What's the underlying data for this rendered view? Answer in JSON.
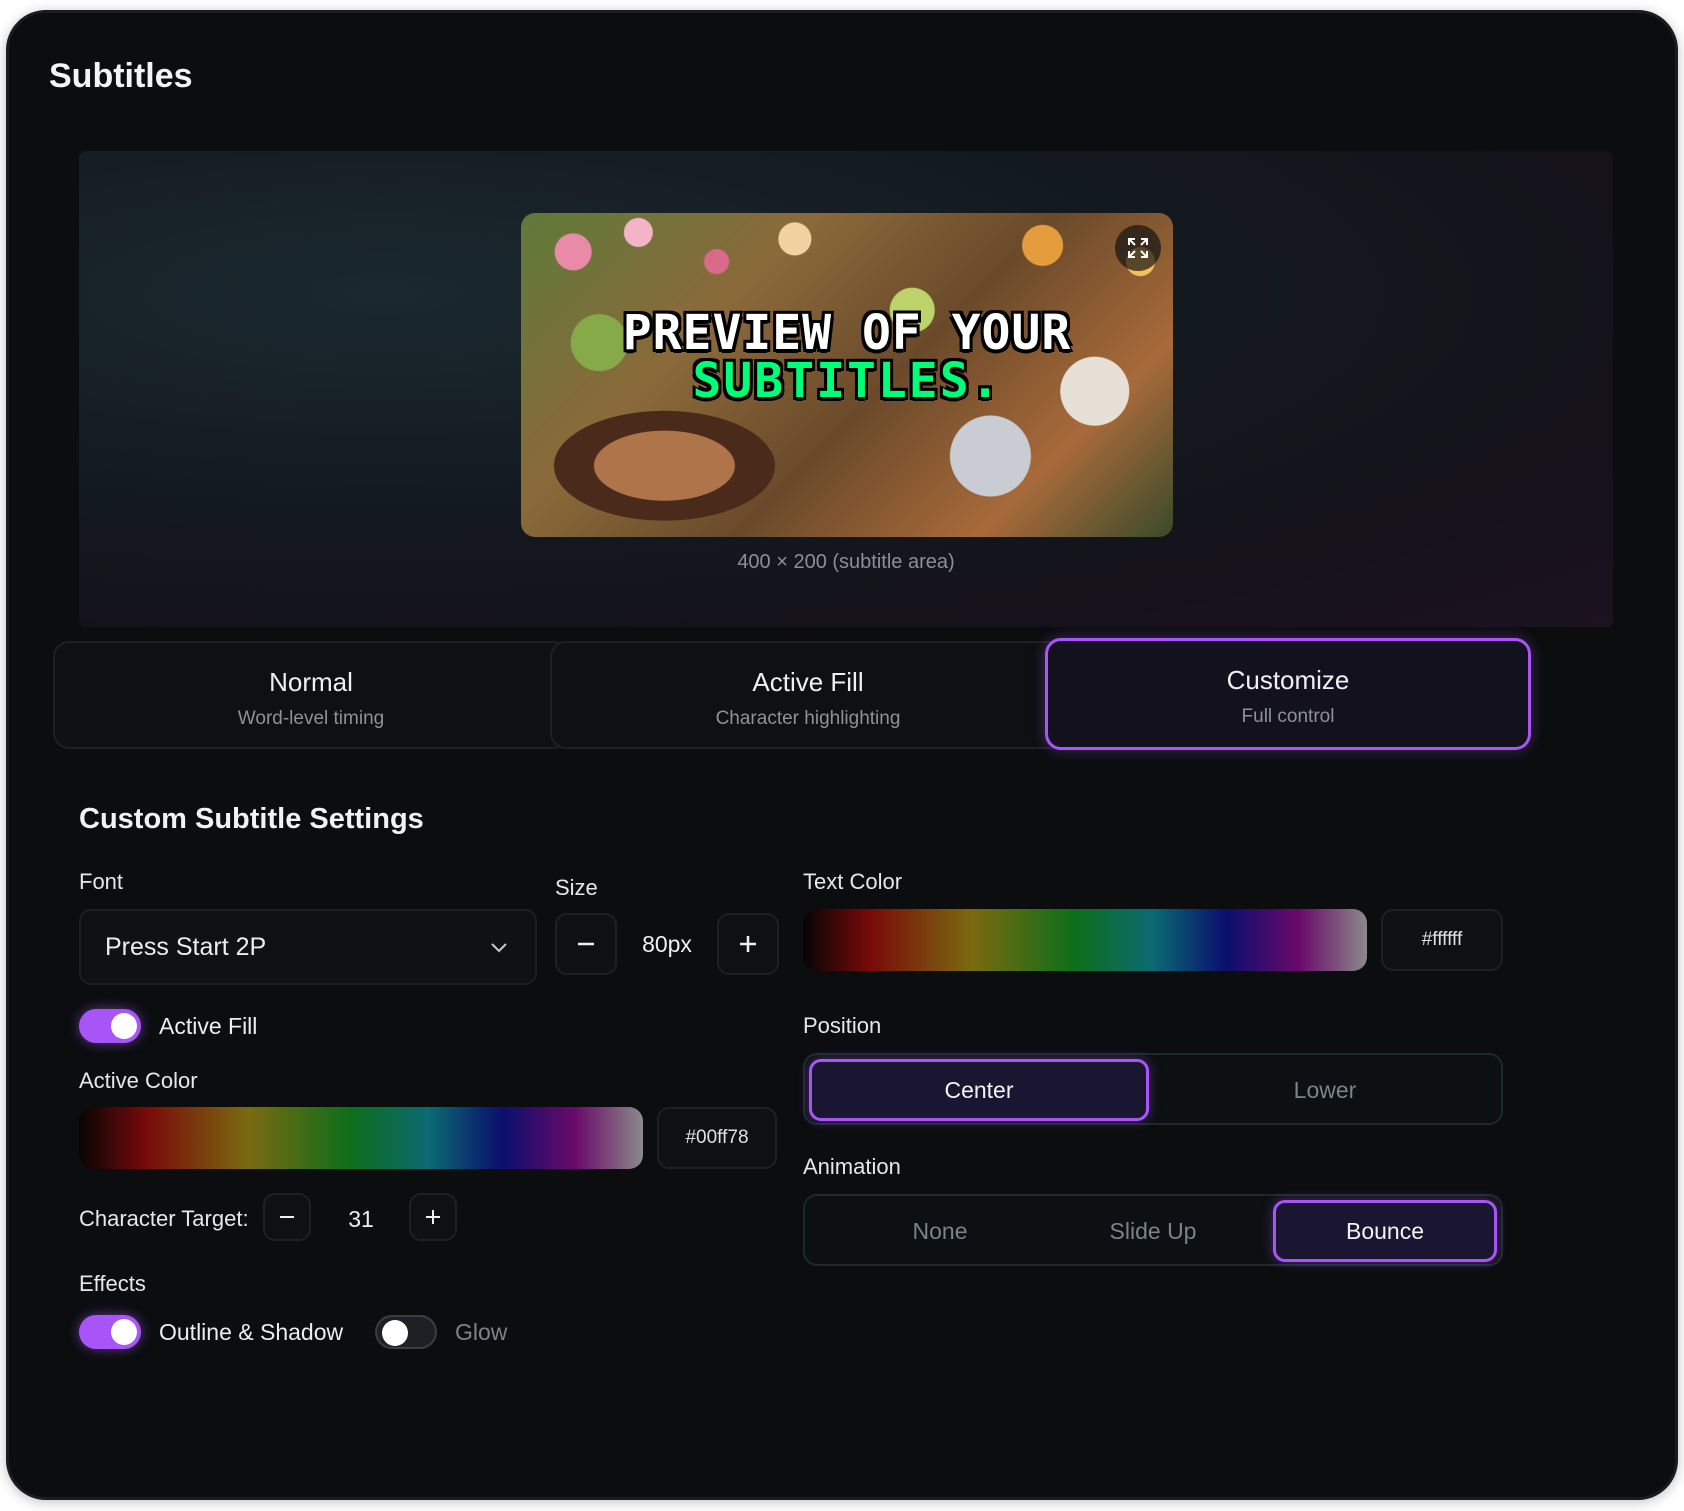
{
  "panel": {
    "title": "Subtitles"
  },
  "preview": {
    "line1": "PREVIEW OF YOUR",
    "line2": "SUBTITLES.",
    "caption": "400 × 200 (subtitle area)"
  },
  "modes": [
    {
      "title": "Normal",
      "subtitle": "Word-level timing",
      "active": false
    },
    {
      "title": "Active Fill",
      "subtitle": "Character highlighting",
      "active": false
    },
    {
      "title": "Customize",
      "subtitle": "Full control",
      "active": true
    }
  ],
  "custom": {
    "title": "Custom Subtitle Settings",
    "font_label": "Font",
    "font_value": "Press Start 2P",
    "size_label": "Size",
    "size_value": "80px",
    "text_color_label": "Text Color",
    "text_color_hex": "#ffffff",
    "active_fill_label": "Active Fill",
    "active_fill_on": true,
    "active_color_label": "Active Color",
    "active_color_hex": "#00ff78",
    "char_target_label": "Character Target:",
    "char_target_value": "31",
    "effects_label": "Effects",
    "outline_label": "Outline & Shadow",
    "outline_on": true,
    "glow_label": "Glow",
    "glow_on": false,
    "position_label": "Position",
    "position_options": [
      "Center",
      "Lower"
    ],
    "position_selected": "Center",
    "animation_label": "Animation",
    "animation_options": [
      "None",
      "Slide Up",
      "Bounce"
    ],
    "animation_selected": "Bounce"
  },
  "colors": {
    "accent": "#a855f7",
    "active_green": "#00ff78",
    "bg": "#0b0d0f"
  },
  "icons": {
    "expand": "expand-icon",
    "dropdown": "chevron-down-icon",
    "minus": "minus-icon",
    "plus": "plus-icon"
  }
}
